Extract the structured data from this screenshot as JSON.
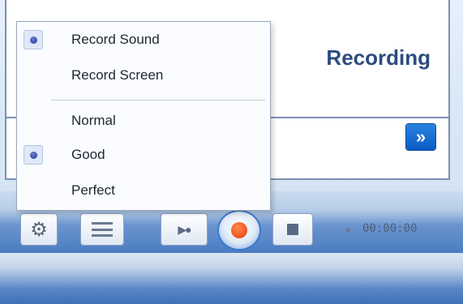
{
  "window": {
    "title": "Recording",
    "next_label": "»"
  },
  "menu": {
    "items": [
      {
        "label": "Record Sound",
        "selected": true
      },
      {
        "label": "Record Screen",
        "selected": false
      },
      {
        "label": "Normal",
        "selected": false
      },
      {
        "label": "Good",
        "selected": true
      },
      {
        "label": "Perfect",
        "selected": false
      }
    ]
  },
  "toolbar": {
    "settings_icon": "gear-icon",
    "list_icon": "list-icon",
    "play_icon": "play-record-icon",
    "record_icon": "record-icon",
    "stop_icon": "stop-icon",
    "timer": "00:00:00"
  },
  "colors": {
    "accent": "#2c4c7e",
    "record": "#e83a10",
    "next_button": "#0b5bc3"
  }
}
